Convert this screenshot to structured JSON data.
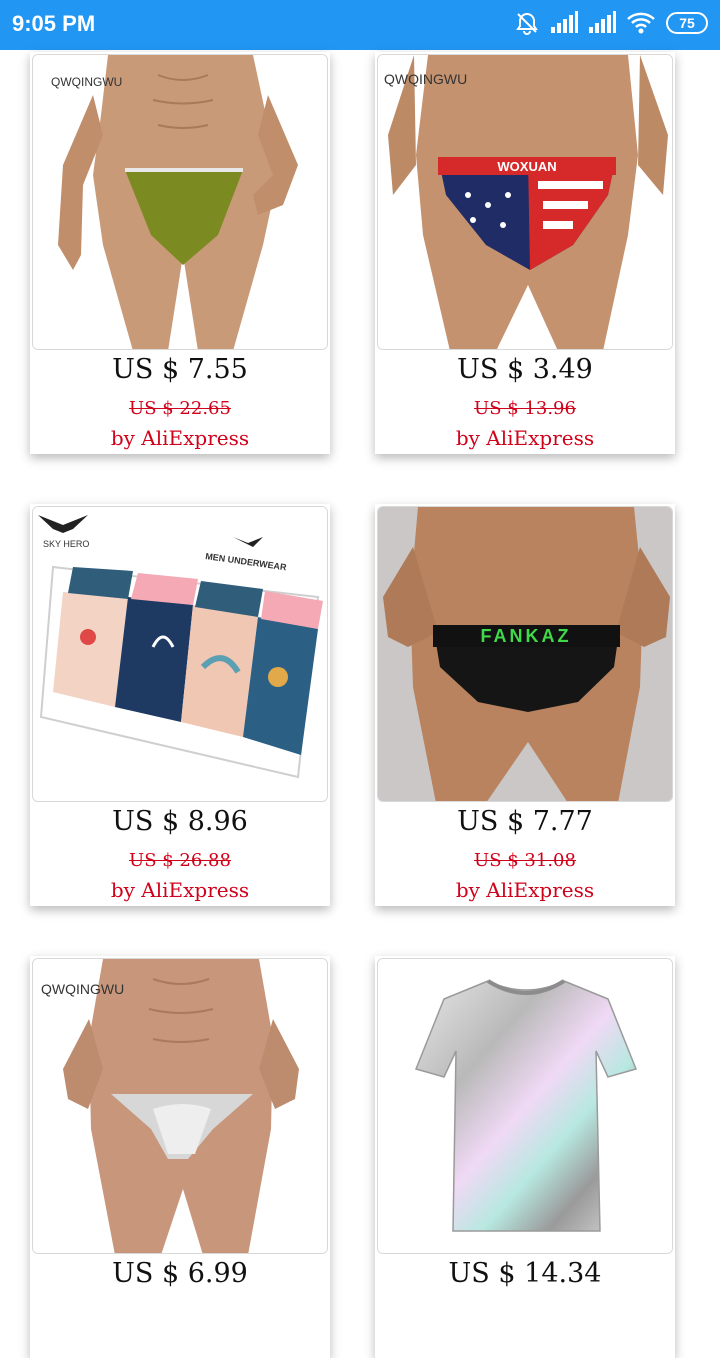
{
  "status_bar": {
    "time": "9:05 PM",
    "battery": "75",
    "icons": [
      "alarm-off-icon",
      "signal-icon",
      "signal-icon",
      "wifi-icon",
      "battery-icon"
    ]
  },
  "products": [
    {
      "brand": "QWQINGWU",
      "image": "olive-brief-model",
      "price": "US $ 7.55",
      "old_price": "US $ 22.65",
      "seller": "by AliExpress"
    },
    {
      "brand": "QWQINGWU",
      "image": "stars-stripes-brief-model",
      "waistband": "WOXUAN",
      "price": "US $ 3.49",
      "old_price": "US $ 13.96",
      "seller": "by AliExpress"
    },
    {
      "brand": "SKY HERO",
      "box_text": "MEN UNDERWEAR",
      "image": "boxer-gift-box",
      "price": "US $ 8.96",
      "old_price": "US $ 26.88",
      "seller": "by AliExpress"
    },
    {
      "brand": "",
      "image": "black-brief-model",
      "waistband": "FANKAZ",
      "price": "US $ 7.77",
      "old_price": "US $ 31.08",
      "seller": "by AliExpress"
    },
    {
      "brand": "QWQINGWU",
      "image": "silver-thong-model",
      "price": "US $ 6.99",
      "old_price": "",
      "seller": ""
    },
    {
      "brand": "",
      "image": "holographic-tshirt",
      "price": "US $ 14.34",
      "old_price": "",
      "seller": ""
    }
  ],
  "colors": {
    "status_bar": "#2196f3",
    "sale_red": "#d0021b"
  }
}
